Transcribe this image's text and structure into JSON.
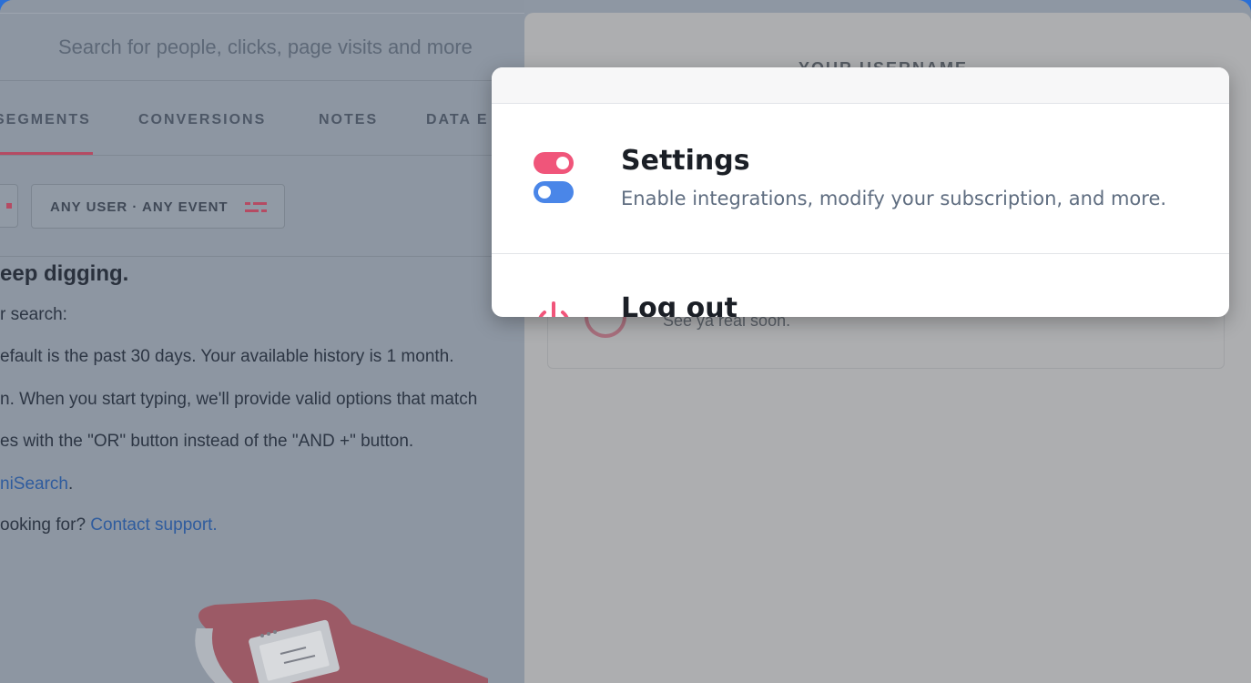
{
  "search": {
    "placeholder": "Search for people, clicks, page visits and more"
  },
  "tabs": [
    {
      "label": "SEGMENTS",
      "active": true
    },
    {
      "label": "CONVERSIONS",
      "active": false
    },
    {
      "label": "NOTES",
      "active": false
    },
    {
      "label": "DATA E",
      "active": false
    }
  ],
  "filter": {
    "chip_label": "ANY USER · ANY EVENT",
    "icon": "filter-sliders-icon"
  },
  "help": {
    "heading": "eep digging.",
    "line1": "r search:",
    "line2": "efault is the past 30 days. Your available history is 1 month.",
    "line3": "n. When you start typing, we'll provide valid options that match",
    "line4": "es with the \"OR\" button instead of the \"AND +\" button.",
    "line5_link": "niSearch",
    "line5_suffix": ".",
    "line6_prefix": "ooking for? ",
    "line6_link": "Contact support."
  },
  "panel": {
    "username_label": "YOUR USERNAME",
    "logout_subtitle": "See ya real soon."
  },
  "menu": {
    "settings": {
      "title": "Settings",
      "description": "Enable integrations, modify your subscription, and more.",
      "icon": "toggle-switches-icon"
    },
    "logout": {
      "title": "Log out",
      "icon": "power-icon"
    }
  },
  "colors": {
    "accent_pink": "#f0557a",
    "accent_blue": "#4a86e8",
    "link_blue": "#2f5c9e",
    "window_border_blue": "#2a6fd6"
  }
}
